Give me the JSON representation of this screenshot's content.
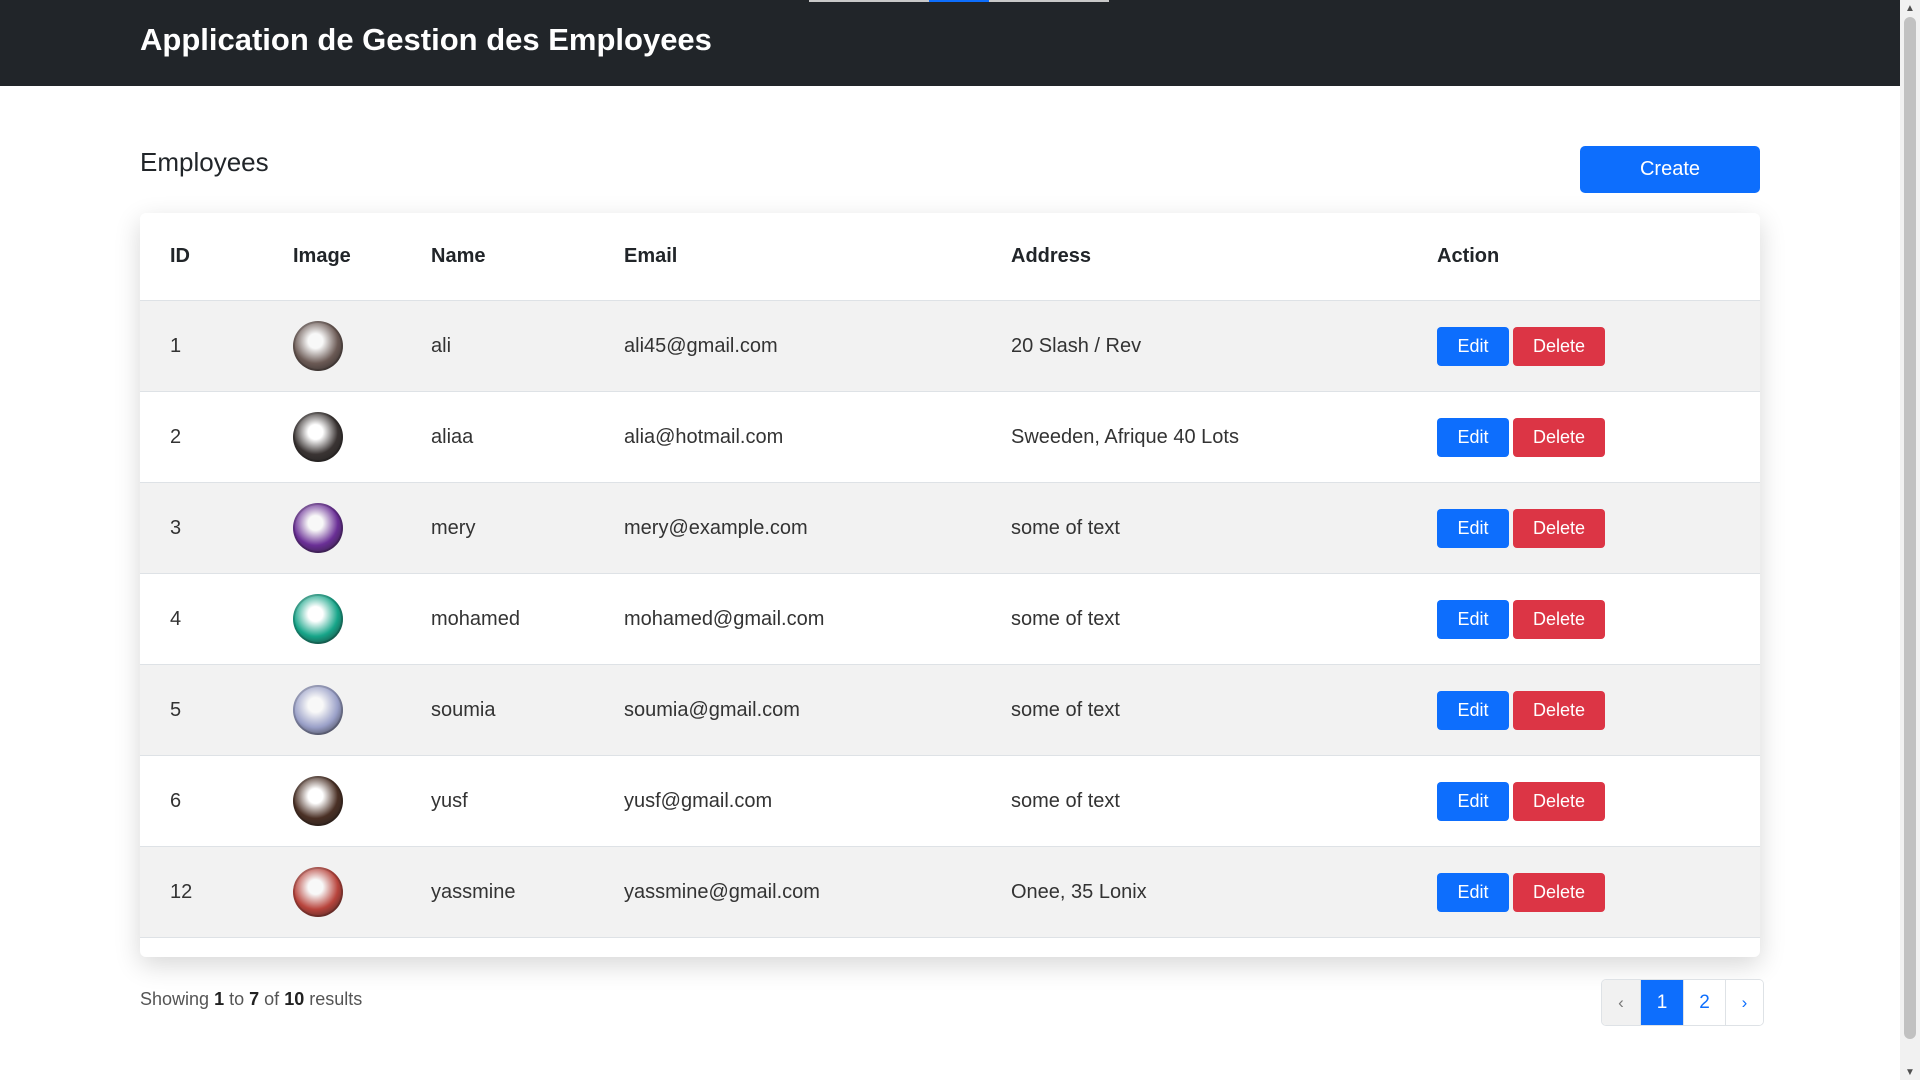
{
  "header": {
    "brand": "Application de Gestion des Employees"
  },
  "page": {
    "heading": "Employees",
    "create_label": "Create"
  },
  "table": {
    "columns": [
      "ID",
      "Image",
      "Name",
      "Email",
      "Address",
      "Action"
    ],
    "edit_label": "Edit",
    "delete_label": "Delete",
    "rows": [
      {
        "id": "1",
        "name": "ali",
        "email": "ali45@gmail.com",
        "address": "20 Slash / Rev",
        "avatar_color": "#6b5a55"
      },
      {
        "id": "2",
        "name": "aliaa",
        "email": "alia@hotmail.com",
        "address": "Sweeden, Afrique 40 Lots",
        "avatar_color": "#3a3433"
      },
      {
        "id": "3",
        "name": "mery",
        "email": "mery@example.com",
        "address": "some of text",
        "avatar_color": "#6a2f96"
      },
      {
        "id": "4",
        "name": "mohamed",
        "email": "mohamed@gmail.com",
        "address": "some of text",
        "avatar_color": "#17a589"
      },
      {
        "id": "5",
        "name": "soumia",
        "email": "soumia@gmail.com",
        "address": "some of text",
        "avatar_color": "#9aa0c8"
      },
      {
        "id": "6",
        "name": "yusf",
        "email": "yusf@gmail.com",
        "address": "some of text",
        "avatar_color": "#4a3025"
      },
      {
        "id": "12",
        "name": "yassmine",
        "email": "yassmine@gmail.com",
        "address": "Onee, 35 Lonix",
        "avatar_color": "#b8443c"
      }
    ]
  },
  "summary": {
    "prefix": "Showing",
    "from": "1",
    "to_word": "to",
    "to": "7",
    "of_word": "of",
    "total": "10",
    "suffix": "results"
  },
  "pagination": {
    "prev": "‹",
    "pages": [
      "1",
      "2"
    ],
    "active": "1",
    "next": "›"
  },
  "colors": {
    "primary": "#0d6efd",
    "danger": "#dc3545",
    "navbar": "#212529"
  }
}
